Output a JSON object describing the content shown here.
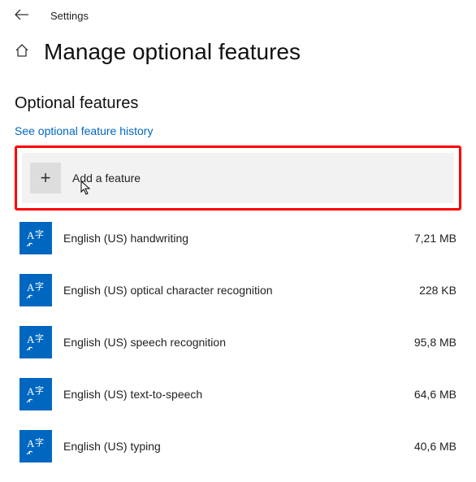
{
  "header": {
    "app_title": "Settings"
  },
  "page": {
    "title": "Manage optional features",
    "section_title": "Optional features",
    "history_link": "See optional feature history",
    "add_feature_label": "Add a feature"
  },
  "features": [
    {
      "label": "English (US) handwriting",
      "size": "7,21 MB"
    },
    {
      "label": "English (US) optical character recognition",
      "size": "228 KB"
    },
    {
      "label": "English (US) speech recognition",
      "size": "95,8 MB"
    },
    {
      "label": "English (US) text-to-speech",
      "size": "64,6 MB"
    },
    {
      "label": "English (US) typing",
      "size": "40,6 MB"
    }
  ]
}
